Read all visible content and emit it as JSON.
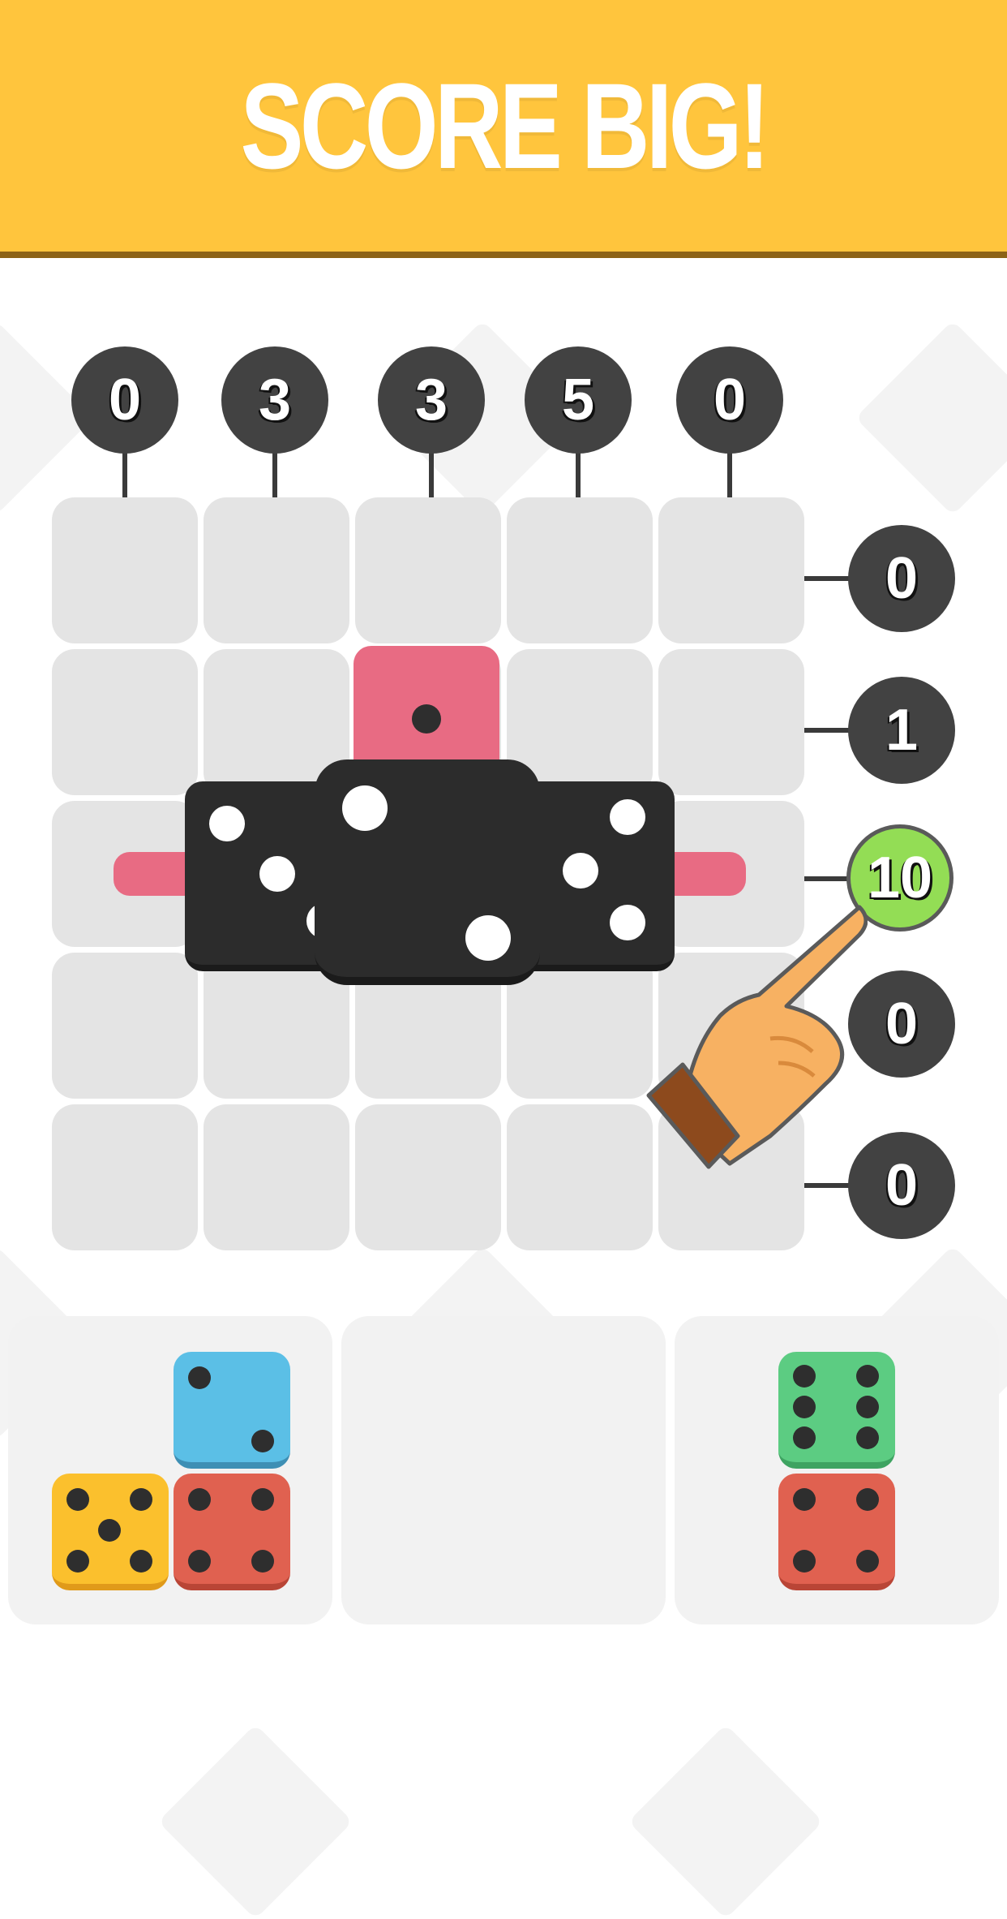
{
  "banner": {
    "title": "SCORE BIG!",
    "color": "#ffc53d"
  },
  "board": {
    "column_scores": [
      "0",
      "3",
      "3",
      "5",
      "0"
    ],
    "row_scores": [
      "0",
      "1",
      "10",
      "0",
      "0"
    ],
    "highlighted_row_index": 2,
    "highlight_color": "#93dd55",
    "cell_color": "#e4e4e4"
  },
  "placed_dice": {
    "pink_die": {
      "pips": 1,
      "color": "#e86b83"
    },
    "black_left_die": {
      "pips": 5,
      "color": "#2c2c2c"
    },
    "black_center_die": {
      "pips": 2,
      "color": "#2c2c2c"
    },
    "black_right_die": {
      "pips": 5,
      "color": "#2c2c2c"
    }
  },
  "trays": [
    {
      "dice": [
        {
          "color": "#5bbfe6",
          "pips": 2
        },
        {
          "color": "#fbc02d",
          "pips": 5
        },
        {
          "color": "#e06150",
          "pips": 4
        }
      ]
    },
    {
      "dice": []
    },
    {
      "dice": [
        {
          "color": "#5ccc82",
          "pips": 6
        },
        {
          "color": "#e06150",
          "pips": 4
        }
      ]
    }
  ],
  "tutorial": {
    "icon": "pointing-hand-icon"
  }
}
